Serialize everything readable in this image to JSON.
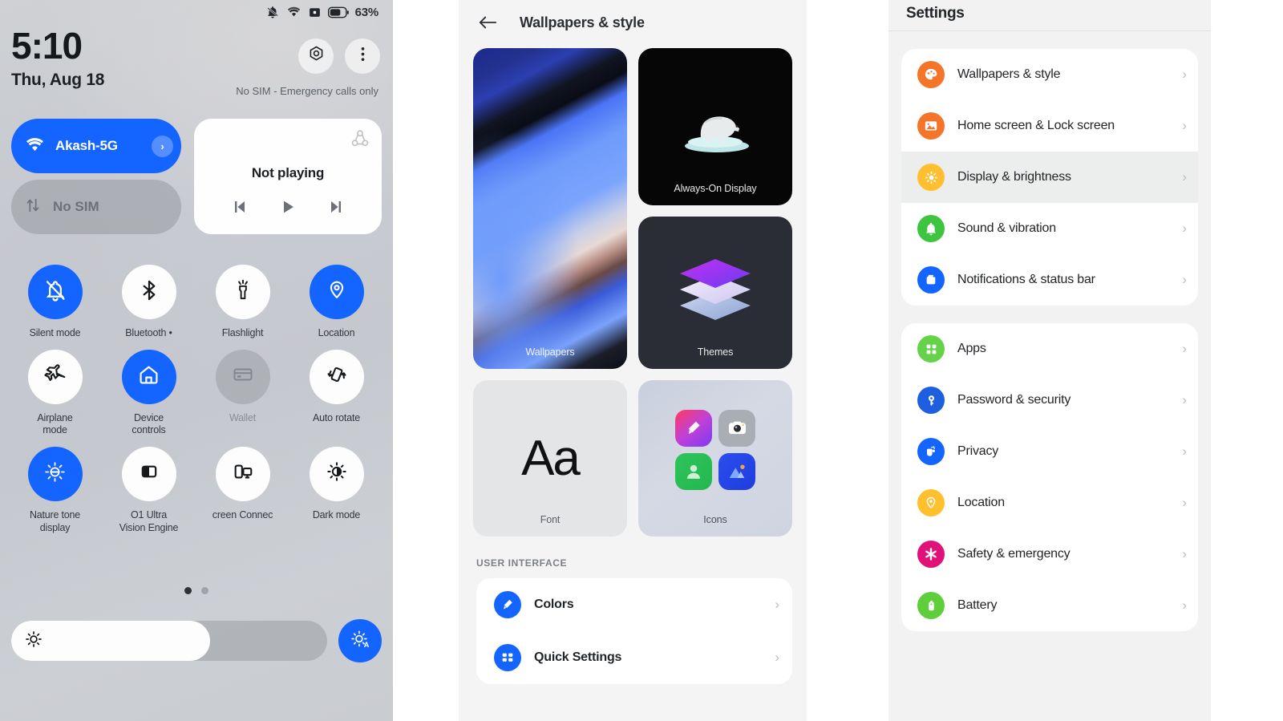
{
  "quick_settings": {
    "status_bar": {
      "battery_percent": "63%",
      "icons": [
        "bell-off-icon",
        "wifi-icon",
        "alarm-icon",
        "battery-icon"
      ]
    },
    "time": "5:10",
    "date": "Thu, Aug 18",
    "sim_status": "No SIM - Emergency calls only",
    "header_buttons": [
      {
        "name": "settings-gear-button",
        "icon": "gear-icon"
      },
      {
        "name": "overflow-menu-button",
        "icon": "three-dots-icon"
      }
    ],
    "wifi_tile": {
      "label": "Akash-5G",
      "icon": "wifi-icon",
      "chevron": "›"
    },
    "sim_tile": {
      "label": "No SIM",
      "icon": "data-arrows-icon"
    },
    "media": {
      "title": "Not playing",
      "cast_icon": "cast-output-icon",
      "controls": [
        "previous-icon",
        "play-icon",
        "next-icon"
      ]
    },
    "tiles": [
      {
        "label": "Silent mode",
        "icon": "bell-off-icon",
        "state": "on"
      },
      {
        "label": "Bluetooth •",
        "icon": "bluetooth-icon",
        "state": "off"
      },
      {
        "label": "Flashlight",
        "icon": "flashlight-icon",
        "state": "off"
      },
      {
        "label": "Location",
        "icon": "location-pin-icon",
        "state": "on"
      },
      {
        "label": "Airplane\nmode",
        "icon": "airplane-icon",
        "state": "off"
      },
      {
        "label": "Device\ncontrols",
        "icon": "home-icon",
        "state": "on"
      },
      {
        "label": "Wallet",
        "icon": "card-icon",
        "state": "disabled"
      },
      {
        "label": "Auto rotate",
        "icon": "rotate-icon",
        "state": "off"
      },
      {
        "label": "Nature tone\ndisplay",
        "icon": "nature-tone-icon",
        "state": "on"
      },
      {
        "label": "O1 Ultra\nVision Engine",
        "icon": "split-square-icon",
        "state": "off"
      },
      {
        "label": "creen Connec",
        "icon": "screen-cast-icon",
        "state": "off"
      },
      {
        "label": "Dark mode",
        "icon": "dark-mode-icon",
        "state": "off"
      }
    ],
    "page_dots": {
      "count": 2,
      "active_index": 0
    },
    "brightness": {
      "icon": "sun-icon",
      "fill_percent": 63,
      "auto_icon": "auto-brightness-icon"
    }
  },
  "wallpapers_style": {
    "back_icon": "arrow-left-icon",
    "title": "Wallpapers & style",
    "cards": [
      {
        "label": "Wallpapers",
        "name": "card-wallpapers"
      },
      {
        "label": "Always-On Display",
        "name": "card-always-on-display"
      },
      {
        "label": "Themes",
        "name": "card-themes"
      },
      {
        "label": "Font",
        "name": "card-font",
        "sample": "Aa"
      },
      {
        "label": "Icons",
        "name": "card-icons"
      }
    ],
    "section_title": "USER INTERFACE",
    "rows": [
      {
        "label": "Colors",
        "icon": "paint-roller-icon",
        "chevron": "›"
      },
      {
        "label": "Quick Settings",
        "icon": "quick-settings-icon",
        "chevron": "›"
      }
    ]
  },
  "settings": {
    "title": "Settings",
    "groups": [
      {
        "items": [
          {
            "label": "Wallpapers & style",
            "icon": "palette-icon",
            "color": "#f4742a",
            "active": false,
            "chevron": "›"
          },
          {
            "label": "Home screen & Lock screen",
            "icon": "image-icon",
            "color": "#f4742a",
            "active": false,
            "chevron": "›"
          },
          {
            "label": "Display & brightness",
            "icon": "sun-icon",
            "color": "#ffbf2e",
            "active": true,
            "chevron": "›"
          },
          {
            "label": "Sound & vibration",
            "icon": "bell-icon",
            "color": "#3fc43f",
            "active": false,
            "chevron": "›"
          },
          {
            "label": "Notifications & status bar",
            "icon": "notification-icon",
            "color": "#1464ff",
            "active": false,
            "chevron": "›"
          }
        ]
      },
      {
        "items": [
          {
            "label": "Apps",
            "icon": "grid-apps-icon",
            "color": "#65d34a",
            "active": false,
            "chevron": "›"
          },
          {
            "label": "Password & security",
            "icon": "key-icon",
            "color": "#1e5fe0",
            "active": false,
            "chevron": "›"
          },
          {
            "label": "Privacy",
            "icon": "privacy-hand-icon",
            "color": "#1464ff",
            "active": false,
            "chevron": "›"
          },
          {
            "label": "Location",
            "icon": "location-pin-icon",
            "color": "#ffc02e",
            "active": false,
            "chevron": "›"
          },
          {
            "label": "Safety & emergency",
            "icon": "emergency-star-icon",
            "color": "#e0127a",
            "active": false,
            "chevron": "›"
          },
          {
            "label": "Battery",
            "icon": "battery-icon",
            "color": "#5ecf3a",
            "active": false,
            "chevron": "›"
          }
        ]
      }
    ]
  }
}
